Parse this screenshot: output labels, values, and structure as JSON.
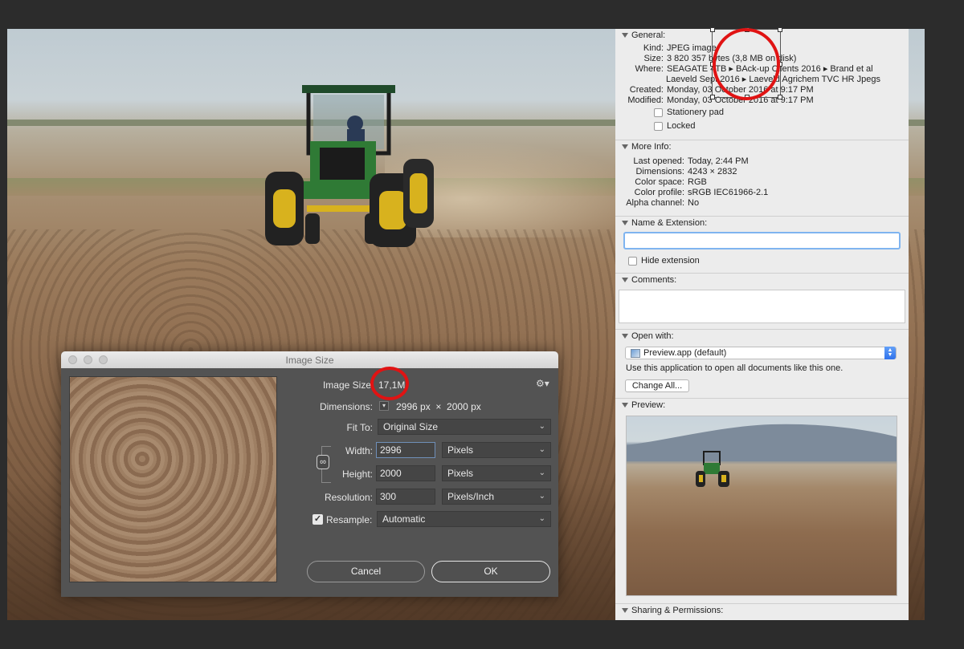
{
  "info": {
    "general": {
      "header": "General:",
      "kind_label": "Kind:",
      "kind": "JPEG image",
      "size_label": "Size:",
      "size": "3 820 357 bytes (3,8 MB on disk)",
      "where_label": "Where:",
      "where_line1": "SEAGATE 4TB ▸ BAck-up Clients 2016 ▸ Brand et al",
      "where_line2": "Laeveld Sept 2016 ▸ Laeveld Agrichem TVC HR Jpegs",
      "created_label": "Created:",
      "created": "Monday, 03 October 2016 at 9:17 PM",
      "modified_label": "Modified:",
      "modified": "Monday, 03 October 2016 at 9:17 PM",
      "stationery": "Stationery pad",
      "locked": "Locked"
    },
    "more_info": {
      "header": "More Info:",
      "last_opened_label": "Last opened:",
      "last_opened": "Today, 2:44 PM",
      "dimensions_label": "Dimensions:",
      "dimensions": "4243 × 2832",
      "color_space_label": "Color space:",
      "color_space": "RGB",
      "color_profile_label": "Color profile:",
      "color_profile": "sRGB IEC61966-2.1",
      "alpha_label": "Alpha channel:",
      "alpha": "No"
    },
    "name_ext": {
      "header": "Name & Extension:",
      "name_value": "",
      "hide_extension": "Hide extension"
    },
    "comments": {
      "header": "Comments:"
    },
    "open_with": {
      "header": "Open with:",
      "app": "Preview.app (default)",
      "hint": "Use this application to open all documents like this one.",
      "change_all": "Change All..."
    },
    "preview": {
      "header": "Preview:"
    },
    "sharing": {
      "header": "Sharing & Permissions:"
    }
  },
  "dialog": {
    "title": "Image Size",
    "image_size_label": "Image Size",
    "image_size_value": "17,1M",
    "dimensions_label": "Dimensions:",
    "dimensions_value": "2996 px  ×  2000 px",
    "fit_to_label": "Fit To:",
    "fit_to_value": "Original Size",
    "width_label": "Width:",
    "width_value": "2996",
    "width_unit": "Pixels",
    "height_label": "Height:",
    "height_value": "2000",
    "height_unit": "Pixels",
    "resolution_label": "Resolution:",
    "resolution_value": "300",
    "resolution_unit": "Pixels/Inch",
    "resample_label": "Resample:",
    "resample_checked": true,
    "resample_value": "Automatic",
    "cancel": "Cancel",
    "ok": "OK"
  },
  "colors": {
    "highlight_ring": "#e01313",
    "dialog_bg": "#535353",
    "panel_bg": "#ececec"
  }
}
